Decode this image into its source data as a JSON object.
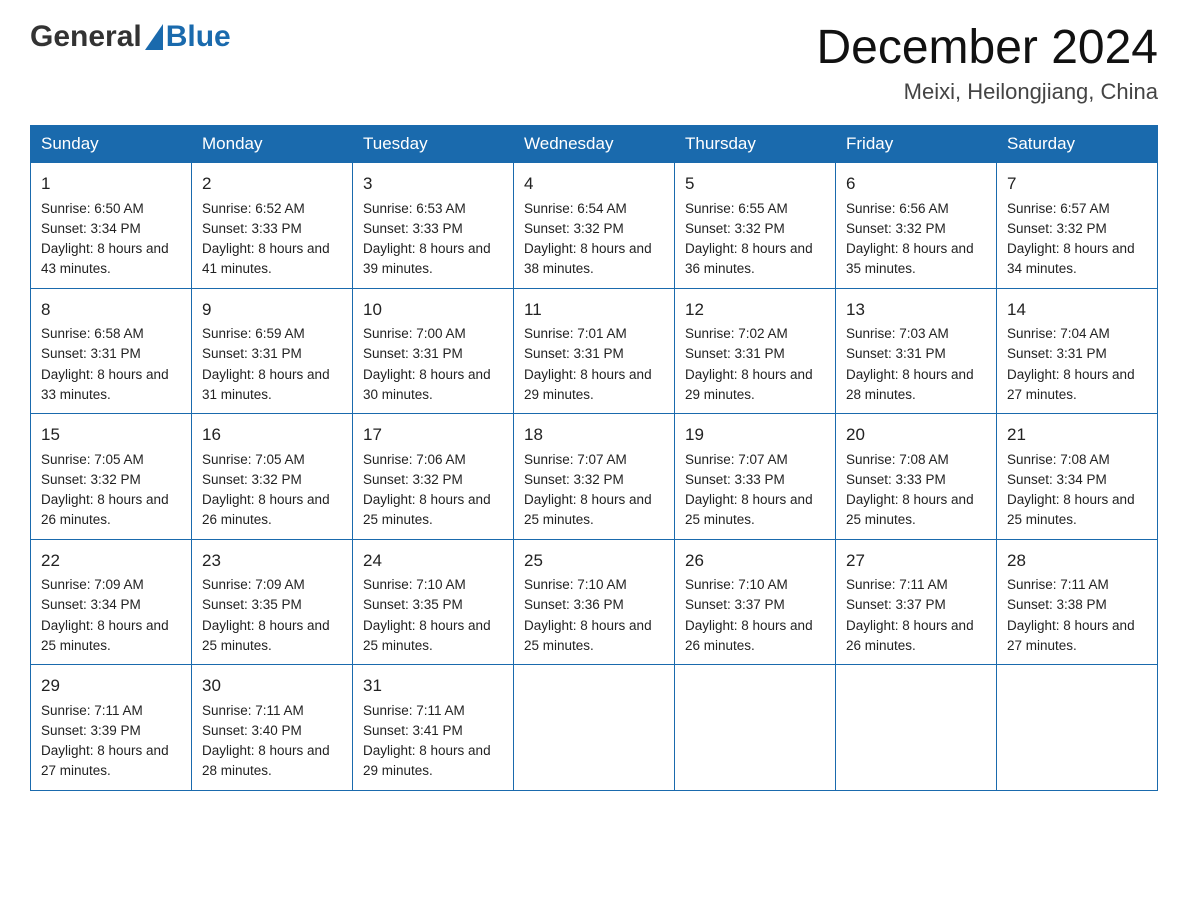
{
  "header": {
    "logo_general": "General",
    "logo_blue": "Blue",
    "month_title": "December 2024",
    "location": "Meixi, Heilongjiang, China"
  },
  "weekdays": [
    "Sunday",
    "Monday",
    "Tuesday",
    "Wednesday",
    "Thursday",
    "Friday",
    "Saturday"
  ],
  "weeks": [
    [
      {
        "day": "1",
        "sunrise": "6:50 AM",
        "sunset": "3:34 PM",
        "daylight": "8 hours and 43 minutes."
      },
      {
        "day": "2",
        "sunrise": "6:52 AM",
        "sunset": "3:33 PM",
        "daylight": "8 hours and 41 minutes."
      },
      {
        "day": "3",
        "sunrise": "6:53 AM",
        "sunset": "3:33 PM",
        "daylight": "8 hours and 39 minutes."
      },
      {
        "day": "4",
        "sunrise": "6:54 AM",
        "sunset": "3:32 PM",
        "daylight": "8 hours and 38 minutes."
      },
      {
        "day": "5",
        "sunrise": "6:55 AM",
        "sunset": "3:32 PM",
        "daylight": "8 hours and 36 minutes."
      },
      {
        "day": "6",
        "sunrise": "6:56 AM",
        "sunset": "3:32 PM",
        "daylight": "8 hours and 35 minutes."
      },
      {
        "day": "7",
        "sunrise": "6:57 AM",
        "sunset": "3:32 PM",
        "daylight": "8 hours and 34 minutes."
      }
    ],
    [
      {
        "day": "8",
        "sunrise": "6:58 AM",
        "sunset": "3:31 PM",
        "daylight": "8 hours and 33 minutes."
      },
      {
        "day": "9",
        "sunrise": "6:59 AM",
        "sunset": "3:31 PM",
        "daylight": "8 hours and 31 minutes."
      },
      {
        "day": "10",
        "sunrise": "7:00 AM",
        "sunset": "3:31 PM",
        "daylight": "8 hours and 30 minutes."
      },
      {
        "day": "11",
        "sunrise": "7:01 AM",
        "sunset": "3:31 PM",
        "daylight": "8 hours and 29 minutes."
      },
      {
        "day": "12",
        "sunrise": "7:02 AM",
        "sunset": "3:31 PM",
        "daylight": "8 hours and 29 minutes."
      },
      {
        "day": "13",
        "sunrise": "7:03 AM",
        "sunset": "3:31 PM",
        "daylight": "8 hours and 28 minutes."
      },
      {
        "day": "14",
        "sunrise": "7:04 AM",
        "sunset": "3:31 PM",
        "daylight": "8 hours and 27 minutes."
      }
    ],
    [
      {
        "day": "15",
        "sunrise": "7:05 AM",
        "sunset": "3:32 PM",
        "daylight": "8 hours and 26 minutes."
      },
      {
        "day": "16",
        "sunrise": "7:05 AM",
        "sunset": "3:32 PM",
        "daylight": "8 hours and 26 minutes."
      },
      {
        "day": "17",
        "sunrise": "7:06 AM",
        "sunset": "3:32 PM",
        "daylight": "8 hours and 25 minutes."
      },
      {
        "day": "18",
        "sunrise": "7:07 AM",
        "sunset": "3:32 PM",
        "daylight": "8 hours and 25 minutes."
      },
      {
        "day": "19",
        "sunrise": "7:07 AM",
        "sunset": "3:33 PM",
        "daylight": "8 hours and 25 minutes."
      },
      {
        "day": "20",
        "sunrise": "7:08 AM",
        "sunset": "3:33 PM",
        "daylight": "8 hours and 25 minutes."
      },
      {
        "day": "21",
        "sunrise": "7:08 AM",
        "sunset": "3:34 PM",
        "daylight": "8 hours and 25 minutes."
      }
    ],
    [
      {
        "day": "22",
        "sunrise": "7:09 AM",
        "sunset": "3:34 PM",
        "daylight": "8 hours and 25 minutes."
      },
      {
        "day": "23",
        "sunrise": "7:09 AM",
        "sunset": "3:35 PM",
        "daylight": "8 hours and 25 minutes."
      },
      {
        "day": "24",
        "sunrise": "7:10 AM",
        "sunset": "3:35 PM",
        "daylight": "8 hours and 25 minutes."
      },
      {
        "day": "25",
        "sunrise": "7:10 AM",
        "sunset": "3:36 PM",
        "daylight": "8 hours and 25 minutes."
      },
      {
        "day": "26",
        "sunrise": "7:10 AM",
        "sunset": "3:37 PM",
        "daylight": "8 hours and 26 minutes."
      },
      {
        "day": "27",
        "sunrise": "7:11 AM",
        "sunset": "3:37 PM",
        "daylight": "8 hours and 26 minutes."
      },
      {
        "day": "28",
        "sunrise": "7:11 AM",
        "sunset": "3:38 PM",
        "daylight": "8 hours and 27 minutes."
      }
    ],
    [
      {
        "day": "29",
        "sunrise": "7:11 AM",
        "sunset": "3:39 PM",
        "daylight": "8 hours and 27 minutes."
      },
      {
        "day": "30",
        "sunrise": "7:11 AM",
        "sunset": "3:40 PM",
        "daylight": "8 hours and 28 minutes."
      },
      {
        "day": "31",
        "sunrise": "7:11 AM",
        "sunset": "3:41 PM",
        "daylight": "8 hours and 29 minutes."
      },
      null,
      null,
      null,
      null
    ]
  ],
  "labels": {
    "sunrise": "Sunrise:",
    "sunset": "Sunset:",
    "daylight": "Daylight:"
  }
}
